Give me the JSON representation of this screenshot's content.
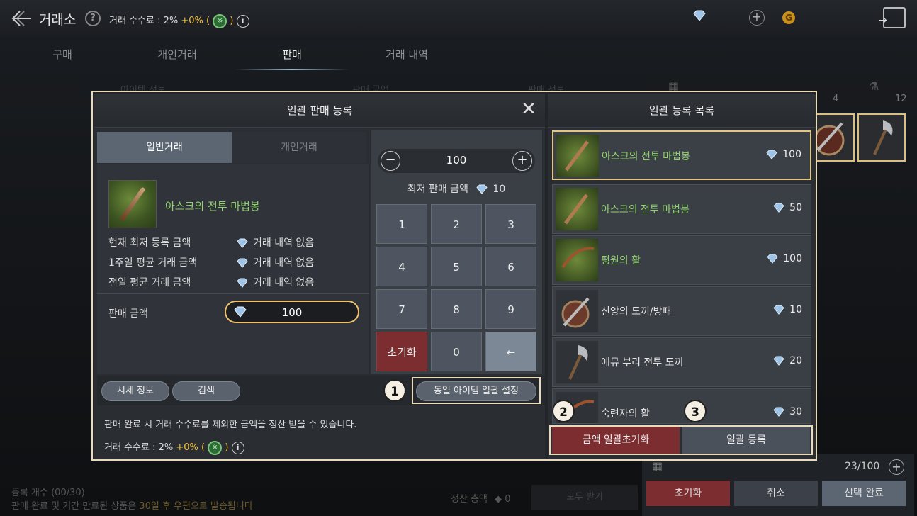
{
  "app": {
    "title": "거래소",
    "help": "?",
    "fee_label": "거래 수수료 : 2%",
    "fee_bonus": "+0%",
    "paren_open": "(",
    "paren_close": ")"
  },
  "top_icons": [
    "diamond-icon",
    "plus-icon",
    "gold-coin-icon",
    "exit-icon"
  ],
  "tabs": [
    {
      "label": "구매"
    },
    {
      "label": "개인거래"
    },
    {
      "label": "판매"
    },
    {
      "label": "거래 내역"
    }
  ],
  "background": {
    "column_headers": [
      "아이템 정보",
      "판매 금액",
      "판매 정보"
    ],
    "inventory_counts": [
      "4",
      "12"
    ],
    "register_count": "등록 개수 (00/30)",
    "register_note": "판매 완료 및 기간 만료된 상품은",
    "register_note_gold": "30일 후 우편으로 발송됩니다",
    "settle_label": "정산 총액",
    "settle_value": "0",
    "receive_all": "모두 받기",
    "capacity": "23/100",
    "btn_reset": "초기화",
    "btn_cancel": "취소",
    "btn_done": "선택 완료"
  },
  "modal": {
    "left_title": "일괄 판매 등록",
    "right_title": "일괄 등록 목록",
    "subtabs": [
      {
        "label": "일반거래"
      },
      {
        "label": "개인거래"
      }
    ],
    "item_name": "아스크의 전투 마법봉",
    "rows": [
      {
        "label": "현재 최저 등록 금액",
        "value": "거래 내역 없음"
      },
      {
        "label": "1주일 평균 거래 금액",
        "value": "거래 내역 없음"
      },
      {
        "label": "전일 평균 거래 금액",
        "value": "거래 내역 없음"
      }
    ],
    "price_label": "판매 금액",
    "price_value": "100",
    "stepper_value": "100",
    "min_price_label": "최저 판매 금액",
    "min_price_value": "10",
    "keys": [
      "1",
      "2",
      "3",
      "4",
      "5",
      "6",
      "7",
      "8",
      "9",
      "초기화",
      "0",
      "←"
    ],
    "btn_market": "시세 정보",
    "btn_search": "검색",
    "btn_bulk_same": "동일 아이템 일괄 설정",
    "note": "판매 완료 시 거래 수수료를 제외한 금액을 정산 받을 수 있습니다.",
    "fee_label": "거래 수수료 : 2%",
    "fee_bonus": "+0%",
    "callouts": [
      "1",
      "2",
      "3"
    ],
    "list": [
      {
        "name": "아스크의 전투 마법봉",
        "price": "100",
        "color": "#8fd26a"
      },
      {
        "name": "아스크의 전투 마법봉",
        "price": "50",
        "color": "#8fd26a"
      },
      {
        "name": "평원의 활",
        "price": "100",
        "color": "#8fd26a"
      },
      {
        "name": "신앙의 도끼/방패",
        "price": "10",
        "color": "#e6e6e6"
      },
      {
        "name": "에뮤 부리 전투 도끼",
        "price": "20",
        "color": "#e6e6e6"
      },
      {
        "name": "숙련자의 활",
        "price": "30",
        "color": "#e6e6e6"
      }
    ],
    "btn_reset_all": "금액 일괄초기화",
    "btn_register_all": "일괄 등록"
  },
  "colors": {
    "accent_gold": "#f2c23b",
    "highlight": "#eadbb8",
    "item_green": "#8fd26a",
    "danger": "#7b2d2f"
  }
}
